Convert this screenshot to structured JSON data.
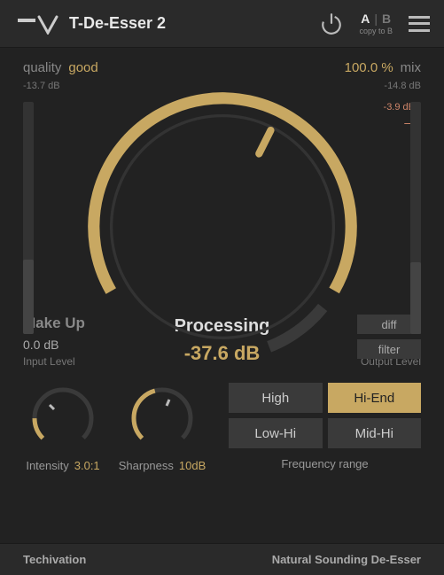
{
  "header": {
    "title": "T-De-Esser 2",
    "ab": {
      "a": "A",
      "sep": "|",
      "b": "B",
      "copy": "copy to B"
    }
  },
  "quality": {
    "label": "quality",
    "value": "good"
  },
  "mix": {
    "value": "100.0 %",
    "label": "mix"
  },
  "meters": {
    "input_db": "-13.7 dB",
    "output_db": "-14.8 dB",
    "peak_db": "-3.9 dB",
    "peak_dash": "–",
    "input_label": "Input Level",
    "output_label": "Output Level"
  },
  "processing": {
    "title": "Processing",
    "value": "-37.6 dB"
  },
  "makeup": {
    "label": "Make Up",
    "value": "0.0 dB"
  },
  "side_toggles": {
    "diff": "diff",
    "filter": "filter"
  },
  "intensity": {
    "label": "Intensity",
    "value": "3.0:1"
  },
  "sharpness": {
    "label": "Sharpness",
    "value": "10dB"
  },
  "freq_range": {
    "label": "Frequency range",
    "options": [
      "High",
      "Hi-End",
      "Low-Hi",
      "Mid-Hi"
    ],
    "active": "Hi-End"
  },
  "footer": {
    "left": "Techivation",
    "right": "Natural Sounding De-Esser"
  },
  "colors": {
    "accent": "#c8a862",
    "peak": "#d0866a",
    "bg": "#222"
  },
  "chart_data": {
    "type": "gauge",
    "main_knob": {
      "range_deg": [
        -210,
        30
      ],
      "value_deg": 22,
      "tick_deg": -65
    },
    "intensity_knob": {
      "range_deg": [
        -225,
        45
      ],
      "value_deg": -180
    },
    "sharpness_knob": {
      "range_deg": [
        -225,
        45
      ],
      "value_deg": -105
    },
    "input_meter_pct": 32,
    "output_meter_pct": 31
  }
}
